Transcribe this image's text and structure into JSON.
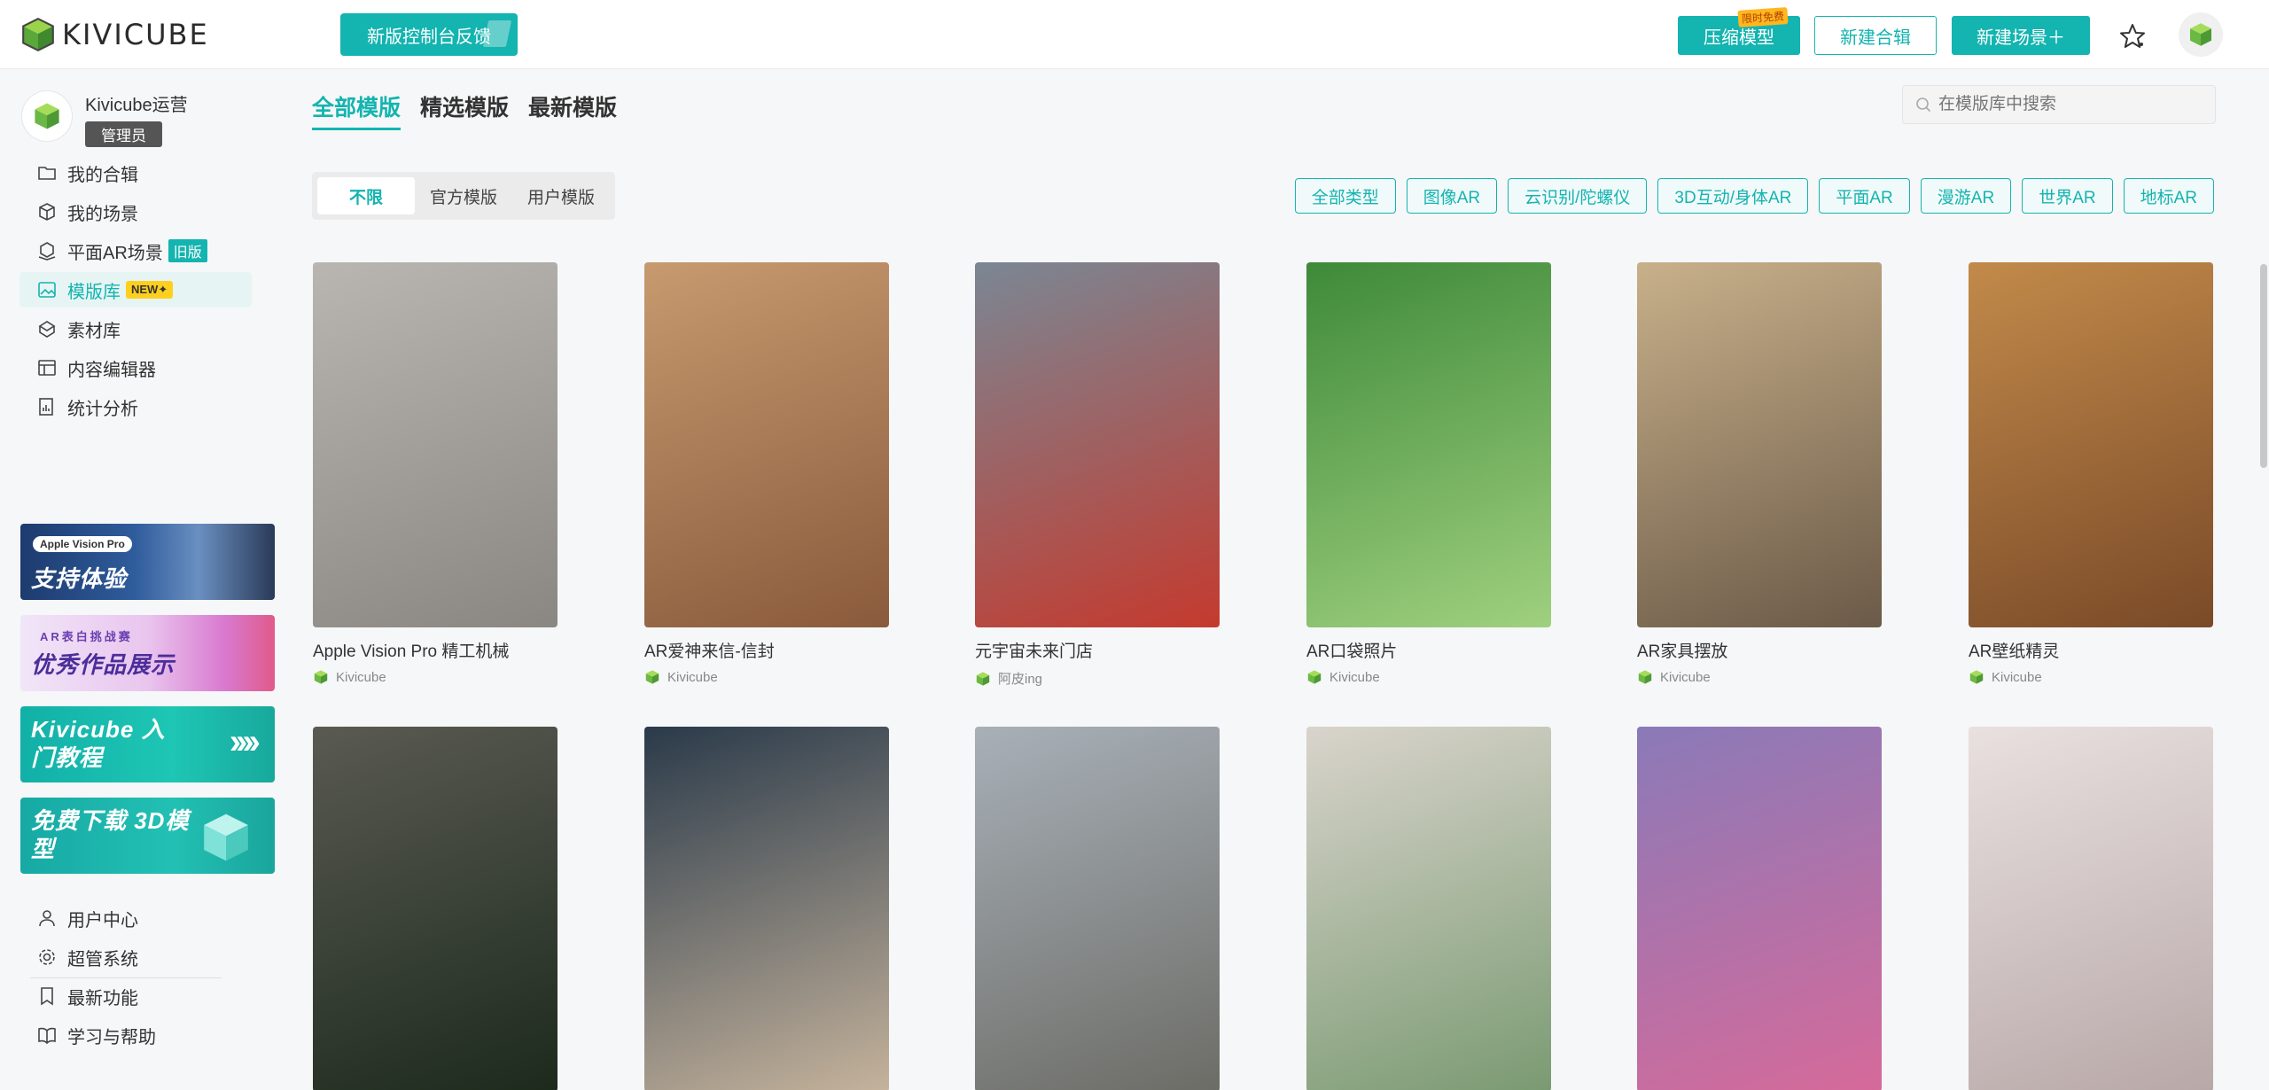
{
  "header": {
    "logo_text": "KIVICUBE",
    "feedback_label": "新版控制台反馈",
    "compress_label": "压缩模型",
    "compress_tag": "限时免费",
    "new_collection_label": "新建合辑",
    "new_scene_label": "新建场景＋",
    "star_icon": "star-icon",
    "accent_color": "#14b4b0"
  },
  "sidebar": {
    "user_name": "Kivicube运营",
    "role": "管理员",
    "nav": [
      {
        "label": "我的合辑",
        "icon": "folder-icon"
      },
      {
        "label": "我的场景",
        "icon": "cube-icon"
      },
      {
        "label": "平面AR场景",
        "icon": "plane-cube-icon",
        "tag": "旧版"
      },
      {
        "label": "模版库",
        "icon": "image-icon",
        "tag": "NEW✦"
      },
      {
        "label": "素材库",
        "icon": "asset-icon"
      },
      {
        "label": "内容编辑器",
        "icon": "editor-icon"
      },
      {
        "label": "统计分析",
        "icon": "chart-icon"
      }
    ],
    "banners": [
      {
        "text": "支持体验",
        "sub": "Apple Vision Pro"
      },
      {
        "text": "优秀作品展示",
        "sub": "AR表白挑战赛"
      },
      {
        "text": "Kivicube 入门教程",
        "sub": ""
      },
      {
        "text": "免费下载 3D模型",
        "sub": ""
      }
    ],
    "bottom_nav": [
      {
        "label": "用户中心",
        "icon": "user-icon"
      },
      {
        "label": "超管系统",
        "icon": "settings-icon"
      },
      {
        "label": "最新功能",
        "icon": "bookmark-icon"
      },
      {
        "label": "学习与帮助",
        "icon": "book-icon"
      }
    ]
  },
  "main": {
    "tabs": [
      "全部模版",
      "精选模版",
      "最新模版"
    ],
    "search_placeholder": "在模版库中搜索",
    "segments": [
      "不限",
      "官方模版",
      "用户模版"
    ],
    "filters": [
      "全部类型",
      "图像AR",
      "云识别/陀螺仪",
      "3D互动/身体AR",
      "平面AR",
      "漫游AR",
      "世界AR",
      "地标AR"
    ],
    "cards": [
      {
        "title": "Apple Vision Pro 精工机械",
        "author": "Kivicube",
        "bg": [
          "#b9b6b2",
          "#8a8783"
        ]
      },
      {
        "title": "AR爱神来信-信封",
        "author": "Kivicube",
        "bg": [
          "#c79a6f",
          "#8a5a3c"
        ]
      },
      {
        "title": "元宇宙未来门店",
        "author": "阿皮ing",
        "bg": [
          "#7a8794",
          "#c43a2e"
        ]
      },
      {
        "title": "AR口袋照片",
        "author": "Kivicube",
        "bg": [
          "#3e8a3a",
          "#9fd07e"
        ]
      },
      {
        "title": "AR家具摆放",
        "author": "Kivicube",
        "bg": [
          "#c8b08a",
          "#6b5a48"
        ]
      },
      {
        "title": "AR壁纸精灵",
        "author": "Kivicube",
        "bg": [
          "#c28a4a",
          "#7a4a28"
        ]
      },
      {
        "title": "",
        "author": "",
        "bg": [
          "#5a5a52",
          "#1c2a1c"
        ]
      },
      {
        "title": "",
        "author": "",
        "bg": [
          "#2a3a4a",
          "#c5b39c"
        ]
      },
      {
        "title": "",
        "author": "",
        "bg": [
          "#a8b0b8",
          "#6c6c66"
        ]
      },
      {
        "title": "",
        "author": "",
        "bg": [
          "#d9d4cc",
          "#7a9a72"
        ]
      },
      {
        "title": "",
        "author": "",
        "bg": [
          "#8a7ab8",
          "#d66a9a"
        ]
      },
      {
        "title": "",
        "author": "",
        "bg": [
          "#e9e0e0",
          "#b8a8a8"
        ]
      }
    ]
  }
}
